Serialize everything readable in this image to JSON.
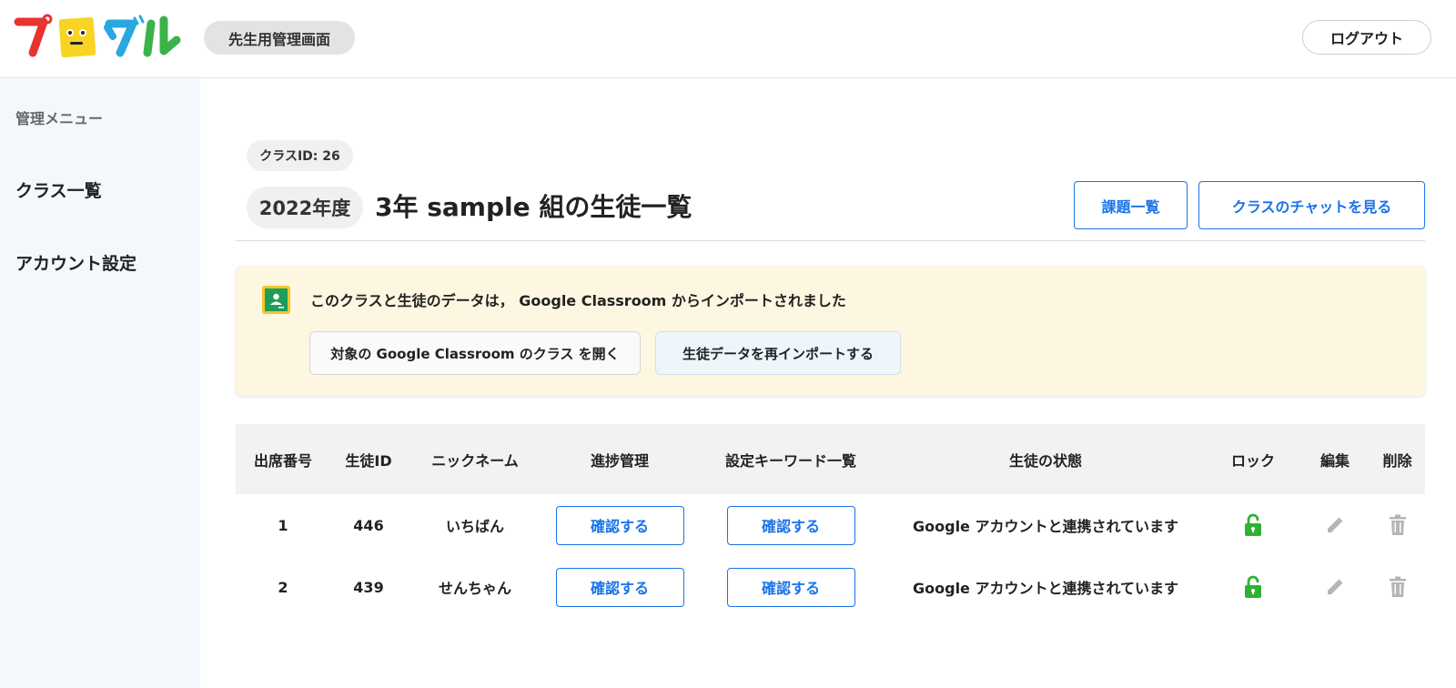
{
  "header": {
    "logo_text": "プログル",
    "admin_label": "先生用管理画面",
    "logout_label": "ログアウト"
  },
  "sidebar": {
    "heading": "管理メニュー",
    "items": [
      {
        "label": "クラス一覧"
      },
      {
        "label": "アカウント設定"
      }
    ]
  },
  "main": {
    "class_id": "クラスID: 26",
    "year": "2022年度",
    "title": "3年 sample 組の生徒一覧",
    "buttons": {
      "assignments": "課題一覧",
      "chat": "クラスのチャットを見る"
    }
  },
  "notice": {
    "text": "このクラスと生徒のデータは， Google Classroom からインポートされました",
    "open_classroom": "対象の Google Classroom のクラス を開く",
    "reimport": "生徒データを再インポートする",
    "icon": "google-classroom-icon"
  },
  "table": {
    "columns": [
      "出席番号",
      "生徒ID",
      "ニックネーム",
      "進捗管理",
      "設定キーワード一覧",
      "生徒の状態",
      "ロック",
      "編集",
      "削除"
    ],
    "rows": [
      {
        "number": "1",
        "id": "446",
        "nickname": "いちばん",
        "progress": "確認する",
        "keywords": "確認する",
        "status": "Google アカウントと連携されています"
      },
      {
        "number": "2",
        "id": "439",
        "nickname": "せんちゃん",
        "progress": "確認する",
        "keywords": "確認する",
        "status": "Google アカウントと連携されています"
      }
    ]
  },
  "colors": {
    "accent": "#1a73e8",
    "lock_green": "#2fb233",
    "sidebar_bg": "#f4f8fc",
    "notice_bg": "#fdf6e0"
  }
}
